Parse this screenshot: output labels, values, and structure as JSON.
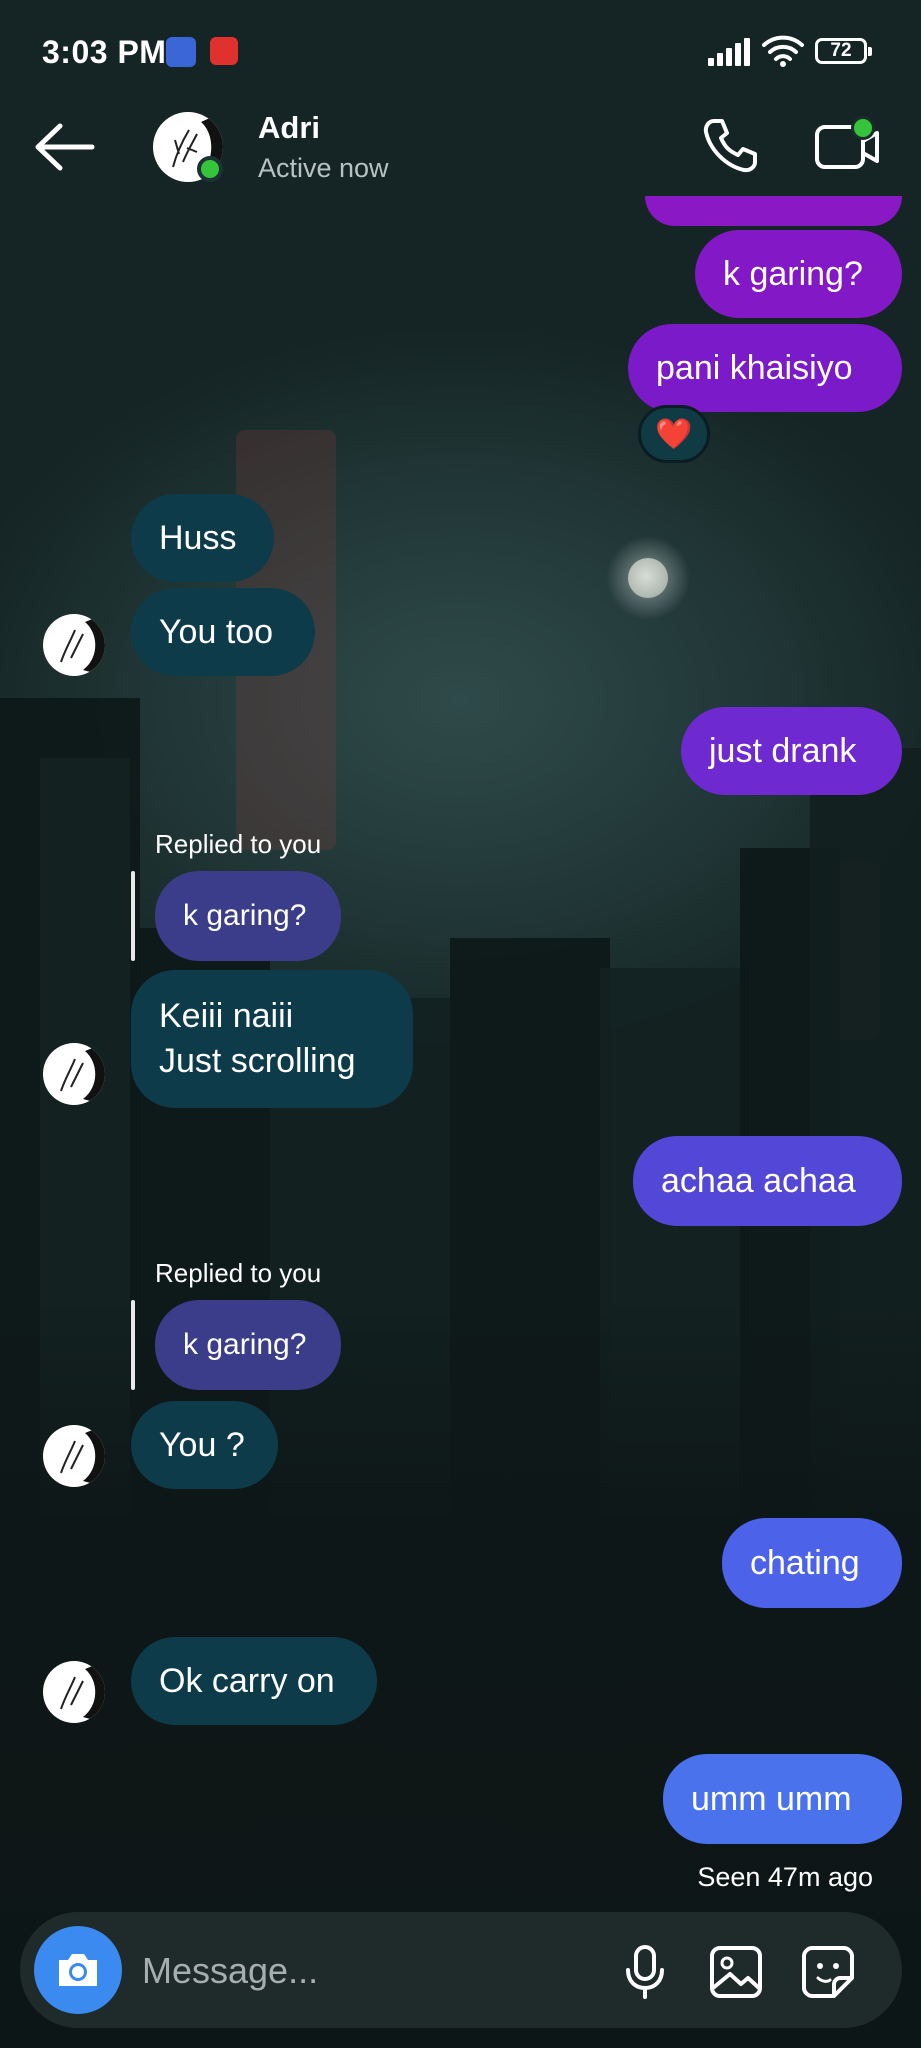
{
  "status_bar": {
    "time": "3:03 PM",
    "battery": "72",
    "icons": [
      "app-notification-icon",
      "app-notification-icon",
      "signal-icon",
      "wifi-icon",
      "battery-icon"
    ]
  },
  "header": {
    "contact_name": "Adri",
    "contact_status": "Active now",
    "icons": [
      "back-arrow-icon",
      "phone-call-icon",
      "video-call-icon"
    ]
  },
  "messages": [
    {
      "direction": "out",
      "text": "k garing?"
    },
    {
      "direction": "out",
      "text": "pani khaisiyo",
      "reaction": "❤️"
    },
    {
      "direction": "in",
      "text": "Huss"
    },
    {
      "direction": "in",
      "text": "You too"
    },
    {
      "direction": "out",
      "text": "just drank"
    },
    {
      "direction": "in",
      "reply_label": "Replied to you",
      "quoted": "k garing?",
      "text": "Keiii naiii\nJust scrolling"
    },
    {
      "direction": "out",
      "text": "achaa achaa"
    },
    {
      "direction": "in",
      "reply_label": "Replied to you",
      "quoted": "k garing?",
      "text": "You ?"
    },
    {
      "direction": "out",
      "text": "chating"
    },
    {
      "direction": "in",
      "text": "Ok carry on"
    },
    {
      "direction": "out",
      "text": "umm umm"
    }
  ],
  "seen_status": "Seen 47m ago",
  "composer": {
    "placeholder": "Message...",
    "icons": [
      "camera-icon",
      "microphone-icon",
      "gallery-icon",
      "sticker-icon"
    ]
  },
  "colors": {
    "incoming_bubble": "#0e3b4a",
    "quoted_bubble": "#3b3c8a",
    "outgoing_gradient_top": "#8a18c4",
    "outgoing_gradient_bottom": "#4a74ee",
    "online_green": "#36c43b",
    "camera_button": "#3a8af0"
  }
}
